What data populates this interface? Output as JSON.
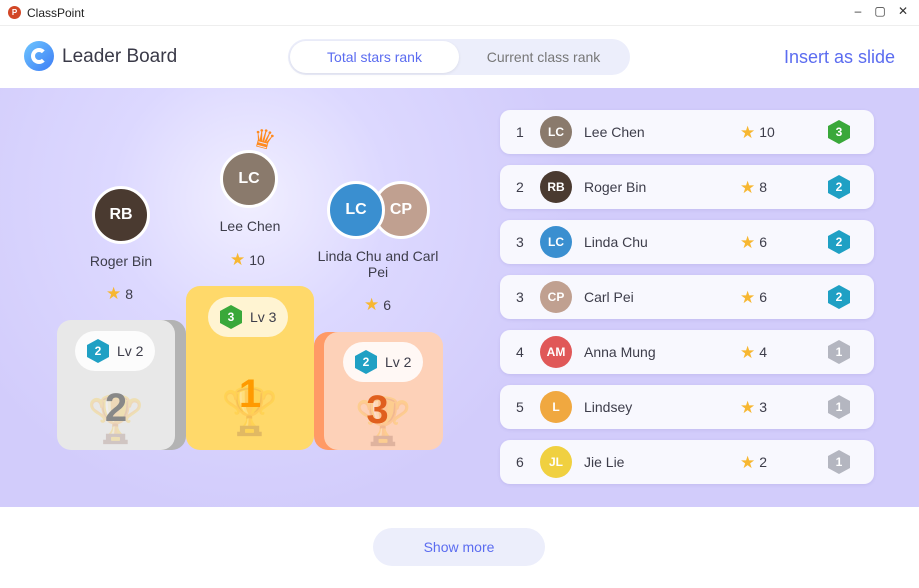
{
  "window": {
    "app_name": "ClassPoint",
    "minimize": "–",
    "maximize": "▢",
    "close": "✕"
  },
  "header": {
    "title": "Leader Board",
    "tabs": [
      {
        "label": "Total stars rank",
        "active": true
      },
      {
        "label": "Current class rank",
        "active": false
      }
    ],
    "insert_label": "Insert as slide"
  },
  "podium": {
    "first": {
      "name": "Lee Chen",
      "stars": "10",
      "level": "Lv 3",
      "level_num": "3",
      "place": "1",
      "initials": "LC",
      "color": "#8a7a6c"
    },
    "second": {
      "name": "Roger Bin",
      "stars": "8",
      "level": "Lv 2",
      "level_num": "2",
      "place": "2",
      "initials": "RB",
      "color": "#4a3a30"
    },
    "third": {
      "name": "Linda Chu and Carl Pei",
      "stars": "6",
      "level": "Lv 2",
      "level_num": "2",
      "place": "3",
      "initials_a": "LC",
      "initials_b": "CP",
      "color_a": "#3a8fd0",
      "color_b": "#c0a090"
    }
  },
  "ranking": [
    {
      "rank": "1",
      "name": "Lee Chen",
      "stars": "10",
      "level": "3",
      "initials": "LC",
      "color": "#8a7a6c"
    },
    {
      "rank": "2",
      "name": "Roger Bin",
      "stars": "8",
      "level": "2",
      "initials": "RB",
      "color": "#4a3a30"
    },
    {
      "rank": "3",
      "name": "Linda Chu",
      "stars": "6",
      "level": "2",
      "initials": "LC",
      "color": "#3a8fd0"
    },
    {
      "rank": "3",
      "name": "Carl Pei",
      "stars": "6",
      "level": "2",
      "initials": "CP",
      "color": "#c0a090"
    },
    {
      "rank": "4",
      "name": "Anna Mung",
      "stars": "4",
      "level": "1",
      "initials": "AM",
      "color": "#e05858"
    },
    {
      "rank": "5",
      "name": "Lindsey",
      "stars": "3",
      "level": "1",
      "initials": "L",
      "color": "#f0a840"
    },
    {
      "rank": "6",
      "name": "Jie Lie",
      "stars": "2",
      "level": "1",
      "initials": "JL",
      "color": "#f0d040"
    }
  ],
  "footer": {
    "show_more": "Show more"
  },
  "colors": {
    "accent": "#5b6cf0",
    "gold": "#ffd96a",
    "silver": "#e8e8e8",
    "bronze": "#fdd1b8"
  }
}
